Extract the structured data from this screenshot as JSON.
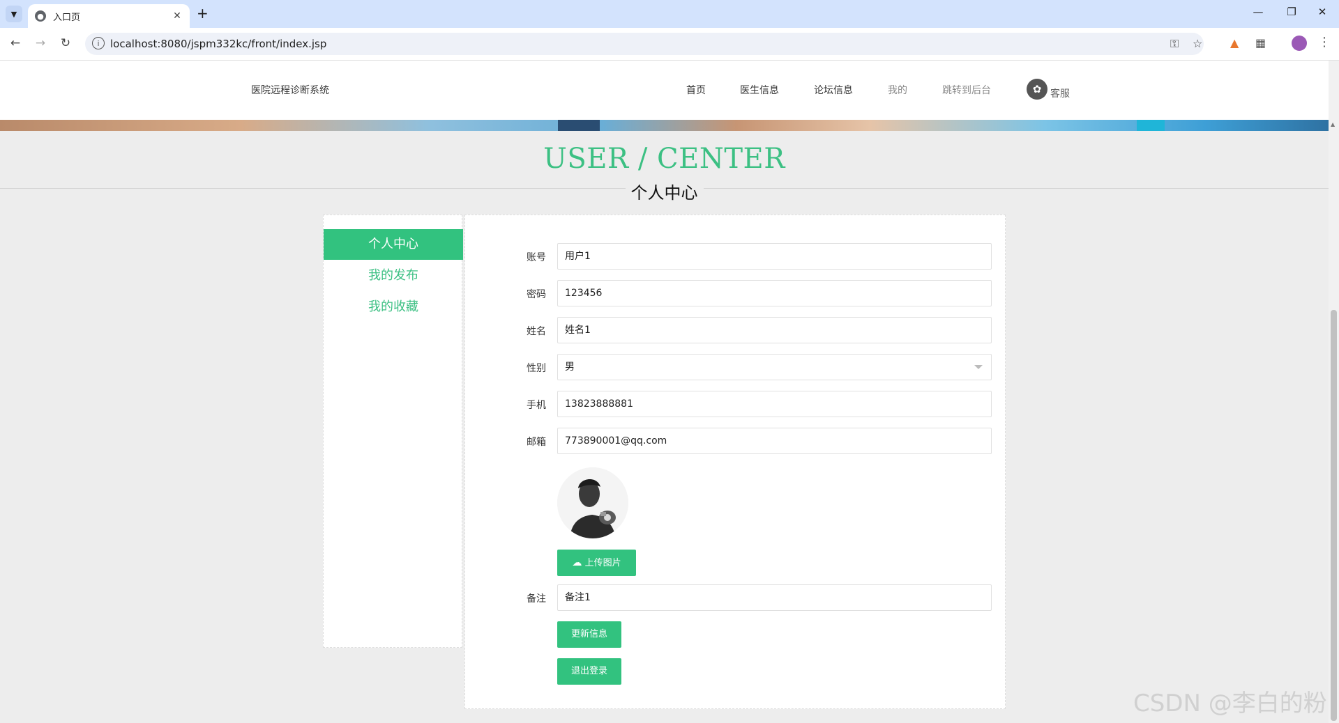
{
  "browser": {
    "tab_title": "入口页",
    "url": "localhost:8080/jspm332kc/front/index.jsp"
  },
  "header": {
    "brand": "医院远程诊断系统",
    "nav": [
      "首页",
      "医生信息",
      "论坛信息",
      "我的",
      "跳转到后台"
    ],
    "service": "客服"
  },
  "section": {
    "title": "USER / CENTER",
    "subtitle": "个人中心"
  },
  "sidebar": {
    "items": [
      "个人中心",
      "我的发布",
      "我的收藏"
    ],
    "active_index": 0
  },
  "form": {
    "fields": [
      {
        "label": "账号",
        "value": "用户1"
      },
      {
        "label": "密码",
        "value": "123456"
      },
      {
        "label": "姓名",
        "value": "姓名1"
      },
      {
        "label": "性别",
        "value": "男"
      },
      {
        "label": "手机",
        "value": "13823888881"
      },
      {
        "label": "邮箱",
        "value": "773890001@qq.com"
      }
    ],
    "upload_label": "上传图片",
    "remark": {
      "label": "备注",
      "value": "备注1"
    },
    "update_label": "更新信息",
    "logout_label": "退出登录"
  },
  "watermark": "CSDN @李白的粉",
  "colors": {
    "accent": "#32c27f",
    "title_green": "#3cc083",
    "tabbar": "#d3e3fd"
  }
}
